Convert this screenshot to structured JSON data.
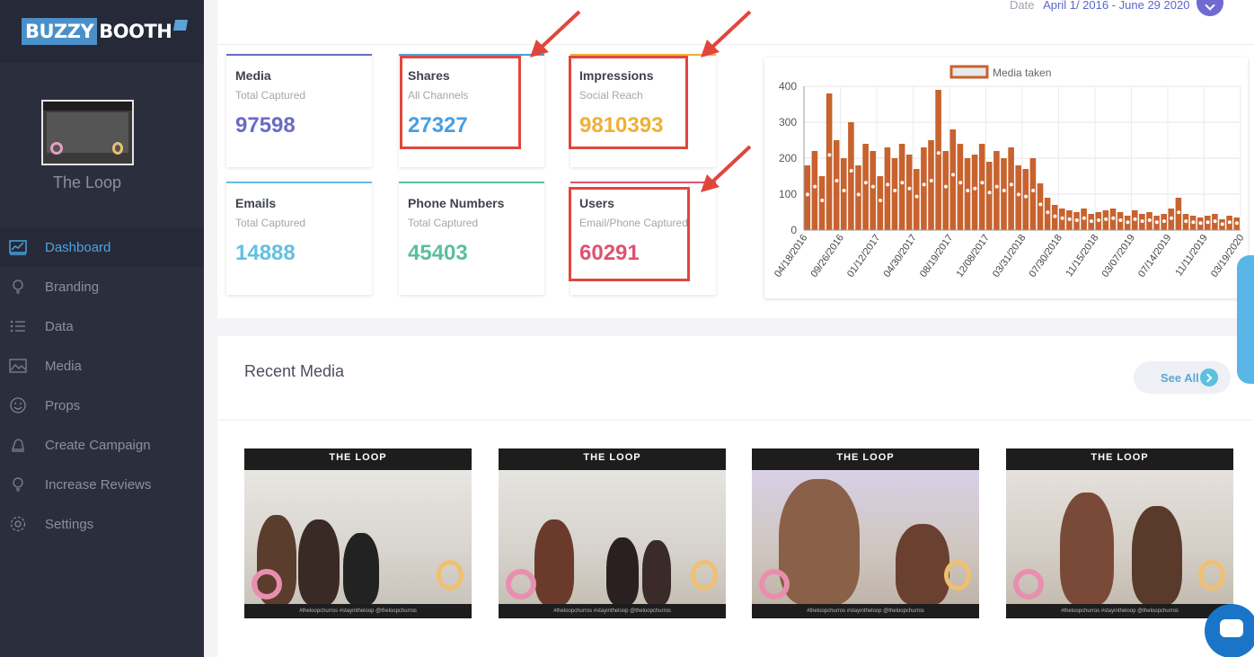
{
  "brand": {
    "logo_left": "BUZZY",
    "logo_right": "BOOTH",
    "event_name": "The Loop"
  },
  "sidebar": {
    "items": [
      {
        "label": "Dashboard",
        "icon": "chart-icon",
        "active": true
      },
      {
        "label": "Branding",
        "icon": "lightbulb-icon"
      },
      {
        "label": "Data",
        "icon": "list-icon"
      },
      {
        "label": "Media",
        "icon": "image-icon"
      },
      {
        "label": "Props",
        "icon": "smiley-icon"
      },
      {
        "label": "Create Campaign",
        "icon": "bell-icon"
      },
      {
        "label": "Increase Reviews",
        "icon": "lightbulb-icon"
      },
      {
        "label": "Settings",
        "icon": "gear-icon"
      }
    ]
  },
  "header": {
    "date_label": "Date",
    "date_range": "April 1/ 2016 - June 29 2020"
  },
  "cards": [
    {
      "title": "Media",
      "subtitle": "Total Captured",
      "value": "97598",
      "color": "#6b6bc4"
    },
    {
      "title": "Shares",
      "subtitle": "All Channels",
      "value": "27327",
      "color": "#4a9ee0"
    },
    {
      "title": "Impressions",
      "subtitle": "Social Reach",
      "value": "9810393",
      "color": "#f0b035"
    },
    {
      "title": "Emails",
      "subtitle": "Total Captured",
      "value": "14888",
      "color": "#64c0e0"
    },
    {
      "title": "Phone Numbers",
      "subtitle": "Total Captured",
      "value": "45403",
      "color": "#5cbf99"
    },
    {
      "title": "Users",
      "subtitle": "Email/Phone Captured",
      "value": "60291",
      "color": "#e05270"
    }
  ],
  "chart_data": {
    "type": "bar",
    "legend": "Media taken",
    "legend_position": "top",
    "ylim": [
      0,
      400
    ],
    "yticks": [
      0,
      100,
      200,
      300,
      400
    ],
    "xticks": [
      "04/18/2016",
      "09/26/2016",
      "01/12/2017",
      "04/30/2017",
      "08/19/2017",
      "12/08/2017",
      "03/31/2018",
      "07/30/2018",
      "11/15/2018",
      "03/07/2019",
      "07/14/2019",
      "11/11/2019",
      "03/19/2020"
    ],
    "series": [
      {
        "name": "Media taken",
        "color": "#c8622e",
        "values": [
          180,
          220,
          150,
          380,
          250,
          200,
          300,
          180,
          240,
          220,
          150,
          230,
          200,
          240,
          210,
          170,
          230,
          250,
          390,
          220,
          280,
          240,
          200,
          210,
          240,
          190,
          220,
          200,
          230,
          180,
          170,
          200,
          130,
          90,
          70,
          60,
          55,
          50,
          60,
          45,
          50,
          55,
          60,
          50,
          40,
          55,
          45,
          50,
          40,
          45,
          60,
          90,
          45,
          40,
          35,
          40,
          45,
          30,
          40,
          35
        ]
      }
    ],
    "grid": true
  },
  "recent_media": {
    "title": "Recent Media",
    "see_all": "See All",
    "photos": [
      {
        "header": "THE LOOP",
        "footer": "#theloopchurros   #stayintheloop   @theloopchurros"
      },
      {
        "header": "THE LOOP",
        "footer": "#theloopchurros   #stayintheloop   @theloopchurros"
      },
      {
        "header": "THE LOOP",
        "footer": "#theloopchurros   #stayintheloop   @theloopchurros"
      },
      {
        "header": "THE LOOP",
        "footer": "#theloopchurros   #stayintheloop   @theloopchurros"
      }
    ]
  }
}
